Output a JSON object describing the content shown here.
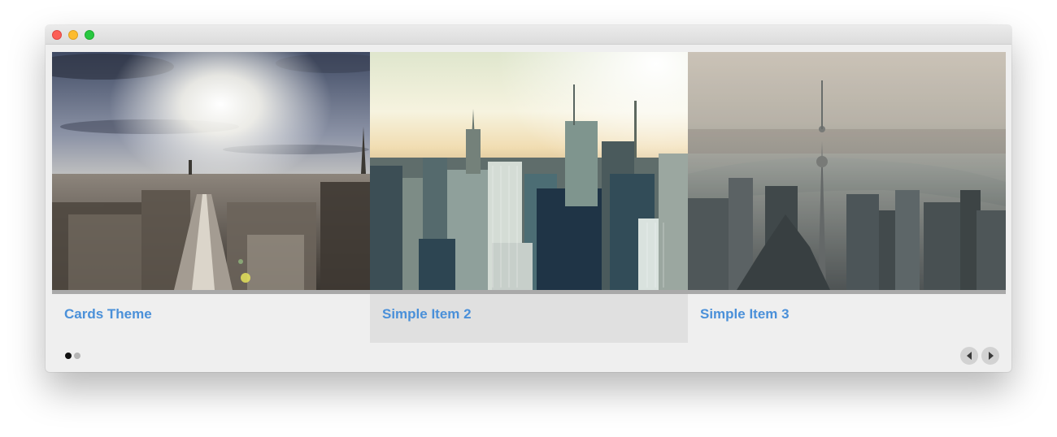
{
  "window": {
    "controls": [
      "close",
      "minimize",
      "maximize"
    ]
  },
  "carousel": {
    "items": [
      {
        "title": "Cards Theme",
        "image": "paris-skyline-photo",
        "active": false
      },
      {
        "title": "Simple Item 2",
        "image": "new-york-skyline-photo",
        "active": true
      },
      {
        "title": "Simple Item 3",
        "image": "shanghai-skyline-photo",
        "active": false
      }
    ],
    "pagination": {
      "pages": 2,
      "current": 1
    },
    "nav": {
      "prev_icon": "chevron-left-icon",
      "next_icon": "chevron-right-icon"
    }
  },
  "colors": {
    "link": "#4a90d9",
    "active_card": "#e0e0e0",
    "card": "#efefef"
  }
}
